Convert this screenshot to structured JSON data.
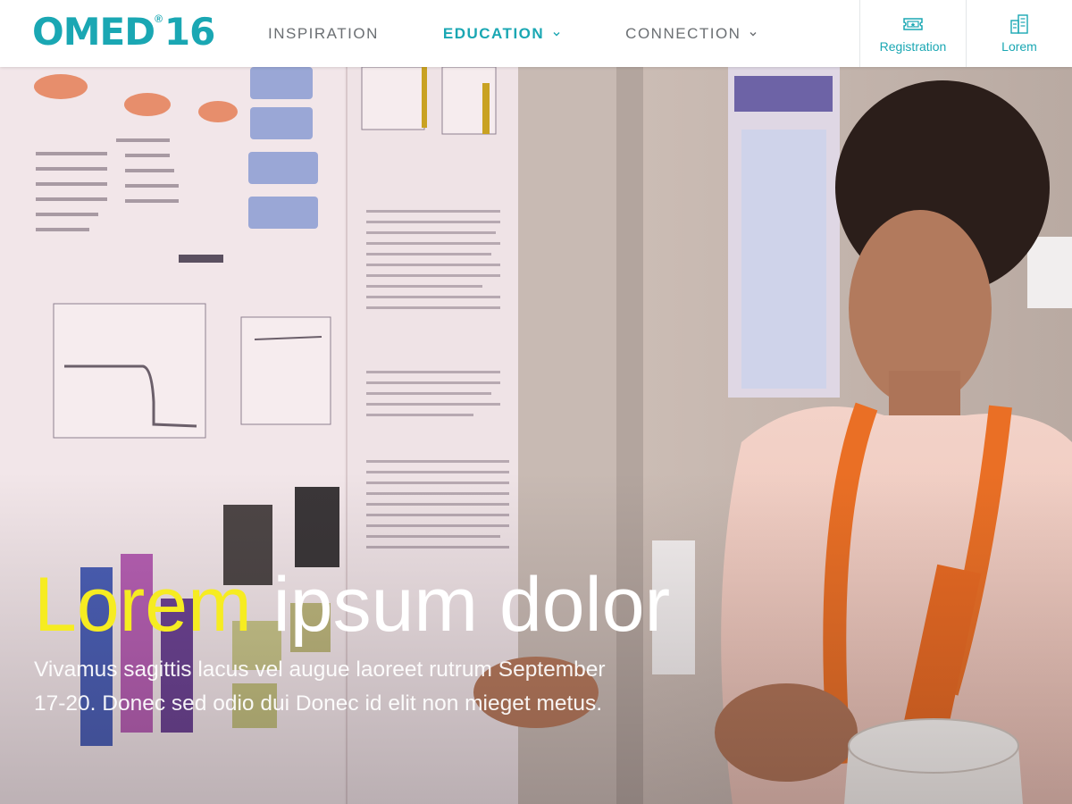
{
  "logo": {
    "text": "OMED",
    "registered": "®",
    "year": "16"
  },
  "nav": {
    "items": [
      {
        "label": "INSPIRATION",
        "active": false,
        "has_dropdown": false
      },
      {
        "label": "EDUCATION",
        "active": true,
        "has_dropdown": true
      },
      {
        "label": "CONNECTION",
        "active": false,
        "has_dropdown": true
      }
    ]
  },
  "actions": {
    "registration": {
      "label": "Registration",
      "icon": "ticket-icon"
    },
    "lorem": {
      "label": "Lorem",
      "icon": "building-icon"
    }
  },
  "hero": {
    "title_highlight": "Lorem",
    "title_rest": " ipsum dolor",
    "subtitle": "Vivamus sagittis lacus vel augue laoreet rutrum September 17-20. Donec sed odio dui Donec id elit non mieget metus."
  },
  "colors": {
    "brand": "#1aa7b3",
    "highlight": "#f6ec21",
    "nav_text": "#6b6f73"
  }
}
